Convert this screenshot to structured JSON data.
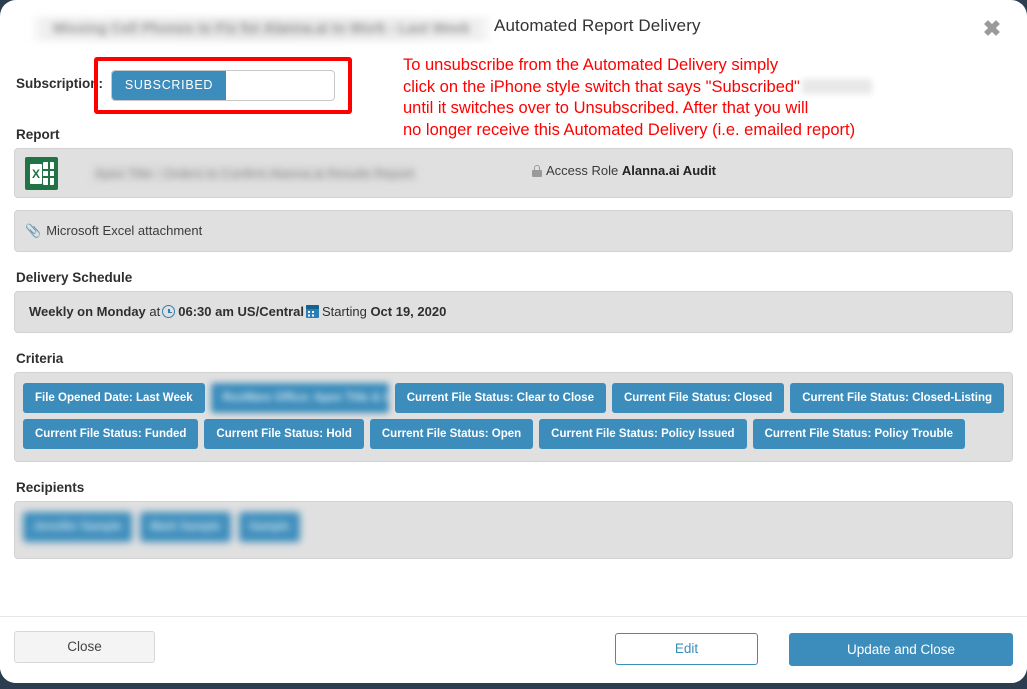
{
  "modal": {
    "title": "Automated Report Delivery",
    "redacted_background_title": "Missing Cell Phones to Fix for Alanna.ai to Work - Last Week",
    "close_icon_label": "✖"
  },
  "subscription": {
    "label": "Subscription:",
    "toggle_state": "SUBSCRIBED",
    "annotation": "To unsubscribe from the Automated Delivery simply\nclick on the iPhone style switch that says \"Subscribed\"\nuntil it switches over to Unsubscribed. After that you will\nno longer receive this Automated Delivery (i.e. emailed report)",
    "highlight_color": "#ff0000",
    "accent_color": "#3c8dbc"
  },
  "report": {
    "section_label": "Report",
    "file_icon": "excel-icon",
    "title_redacted": "Apex Title - Orders to Confirm Alanna.ai Results Report",
    "access_role_label": "Access Role",
    "access_role_value": "Alanna.ai Audit",
    "attachment_text": "Microsoft Excel attachment",
    "attachment_icon": "paperclip-icon"
  },
  "schedule": {
    "section_label": "Delivery Schedule",
    "frequency": "Weekly on Monday",
    "at_word": "at",
    "time": "06:30 am US/Central",
    "starting_word": "Starting",
    "start_date": "Oct 19, 2020"
  },
  "criteria": {
    "section_label": "Criteria",
    "rows": [
      [
        {
          "label": "File Opened Date: Last Week",
          "redacted": false
        },
        {
          "label": "ResWare Office: Apex Title & Closing Services, LLC",
          "redacted": true
        },
        {
          "label": "Current File Status: Clear to Close",
          "redacted": false
        },
        {
          "label": "Current File Status: Closed",
          "redacted": false
        },
        {
          "label": "Current File Status: Closed-Listing",
          "redacted": false
        }
      ],
      [
        {
          "label": "Current File Status: Funded",
          "redacted": false
        },
        {
          "label": "Current File Status: Hold",
          "redacted": false
        },
        {
          "label": "Current File Status: Open",
          "redacted": false
        },
        {
          "label": "Current File Status: Policy Issued",
          "redacted": false
        },
        {
          "label": "Current File Status: Policy Trouble",
          "redacted": false
        }
      ]
    ]
  },
  "recipients": {
    "section_label": "Recipients",
    "chips": [
      {
        "label": "Jennifer Sample",
        "redacted": true
      },
      {
        "label": "Mark Sample",
        "redacted": true
      },
      {
        "label": "Sample",
        "redacted": true
      }
    ]
  },
  "footer": {
    "close_label": "Close",
    "edit_label": "Edit",
    "update_label": "Update and Close"
  }
}
